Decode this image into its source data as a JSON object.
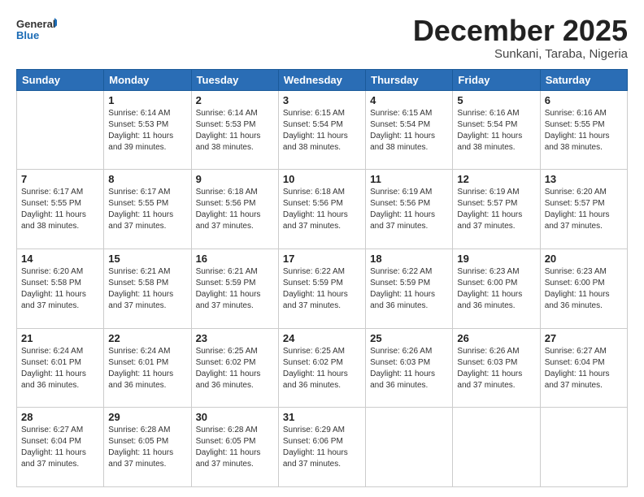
{
  "header": {
    "logo_general": "General",
    "logo_blue": "Blue",
    "month": "December 2025",
    "location": "Sunkani, Taraba, Nigeria"
  },
  "weekdays": [
    "Sunday",
    "Monday",
    "Tuesday",
    "Wednesday",
    "Thursday",
    "Friday",
    "Saturday"
  ],
  "weeks": [
    [
      {
        "day": "",
        "info": ""
      },
      {
        "day": "1",
        "info": "Sunrise: 6:14 AM\nSunset: 5:53 PM\nDaylight: 11 hours\nand 39 minutes."
      },
      {
        "day": "2",
        "info": "Sunrise: 6:14 AM\nSunset: 5:53 PM\nDaylight: 11 hours\nand 38 minutes."
      },
      {
        "day": "3",
        "info": "Sunrise: 6:15 AM\nSunset: 5:54 PM\nDaylight: 11 hours\nand 38 minutes."
      },
      {
        "day": "4",
        "info": "Sunrise: 6:15 AM\nSunset: 5:54 PM\nDaylight: 11 hours\nand 38 minutes."
      },
      {
        "day": "5",
        "info": "Sunrise: 6:16 AM\nSunset: 5:54 PM\nDaylight: 11 hours\nand 38 minutes."
      },
      {
        "day": "6",
        "info": "Sunrise: 6:16 AM\nSunset: 5:55 PM\nDaylight: 11 hours\nand 38 minutes."
      }
    ],
    [
      {
        "day": "7",
        "info": "Sunrise: 6:17 AM\nSunset: 5:55 PM\nDaylight: 11 hours\nand 38 minutes."
      },
      {
        "day": "8",
        "info": "Sunrise: 6:17 AM\nSunset: 5:55 PM\nDaylight: 11 hours\nand 37 minutes."
      },
      {
        "day": "9",
        "info": "Sunrise: 6:18 AM\nSunset: 5:56 PM\nDaylight: 11 hours\nand 37 minutes."
      },
      {
        "day": "10",
        "info": "Sunrise: 6:18 AM\nSunset: 5:56 PM\nDaylight: 11 hours\nand 37 minutes."
      },
      {
        "day": "11",
        "info": "Sunrise: 6:19 AM\nSunset: 5:56 PM\nDaylight: 11 hours\nand 37 minutes."
      },
      {
        "day": "12",
        "info": "Sunrise: 6:19 AM\nSunset: 5:57 PM\nDaylight: 11 hours\nand 37 minutes."
      },
      {
        "day": "13",
        "info": "Sunrise: 6:20 AM\nSunset: 5:57 PM\nDaylight: 11 hours\nand 37 minutes."
      }
    ],
    [
      {
        "day": "14",
        "info": "Sunrise: 6:20 AM\nSunset: 5:58 PM\nDaylight: 11 hours\nand 37 minutes."
      },
      {
        "day": "15",
        "info": "Sunrise: 6:21 AM\nSunset: 5:58 PM\nDaylight: 11 hours\nand 37 minutes."
      },
      {
        "day": "16",
        "info": "Sunrise: 6:21 AM\nSunset: 5:59 PM\nDaylight: 11 hours\nand 37 minutes."
      },
      {
        "day": "17",
        "info": "Sunrise: 6:22 AM\nSunset: 5:59 PM\nDaylight: 11 hours\nand 37 minutes."
      },
      {
        "day": "18",
        "info": "Sunrise: 6:22 AM\nSunset: 5:59 PM\nDaylight: 11 hours\nand 36 minutes."
      },
      {
        "day": "19",
        "info": "Sunrise: 6:23 AM\nSunset: 6:00 PM\nDaylight: 11 hours\nand 36 minutes."
      },
      {
        "day": "20",
        "info": "Sunrise: 6:23 AM\nSunset: 6:00 PM\nDaylight: 11 hours\nand 36 minutes."
      }
    ],
    [
      {
        "day": "21",
        "info": "Sunrise: 6:24 AM\nSunset: 6:01 PM\nDaylight: 11 hours\nand 36 minutes."
      },
      {
        "day": "22",
        "info": "Sunrise: 6:24 AM\nSunset: 6:01 PM\nDaylight: 11 hours\nand 36 minutes."
      },
      {
        "day": "23",
        "info": "Sunrise: 6:25 AM\nSunset: 6:02 PM\nDaylight: 11 hours\nand 36 minutes."
      },
      {
        "day": "24",
        "info": "Sunrise: 6:25 AM\nSunset: 6:02 PM\nDaylight: 11 hours\nand 36 minutes."
      },
      {
        "day": "25",
        "info": "Sunrise: 6:26 AM\nSunset: 6:03 PM\nDaylight: 11 hours\nand 36 minutes."
      },
      {
        "day": "26",
        "info": "Sunrise: 6:26 AM\nSunset: 6:03 PM\nDaylight: 11 hours\nand 37 minutes."
      },
      {
        "day": "27",
        "info": "Sunrise: 6:27 AM\nSunset: 6:04 PM\nDaylight: 11 hours\nand 37 minutes."
      }
    ],
    [
      {
        "day": "28",
        "info": "Sunrise: 6:27 AM\nSunset: 6:04 PM\nDaylight: 11 hours\nand 37 minutes."
      },
      {
        "day": "29",
        "info": "Sunrise: 6:28 AM\nSunset: 6:05 PM\nDaylight: 11 hours\nand 37 minutes."
      },
      {
        "day": "30",
        "info": "Sunrise: 6:28 AM\nSunset: 6:05 PM\nDaylight: 11 hours\nand 37 minutes."
      },
      {
        "day": "31",
        "info": "Sunrise: 6:29 AM\nSunset: 6:06 PM\nDaylight: 11 hours\nand 37 minutes."
      },
      {
        "day": "",
        "info": ""
      },
      {
        "day": "",
        "info": ""
      },
      {
        "day": "",
        "info": ""
      }
    ]
  ]
}
